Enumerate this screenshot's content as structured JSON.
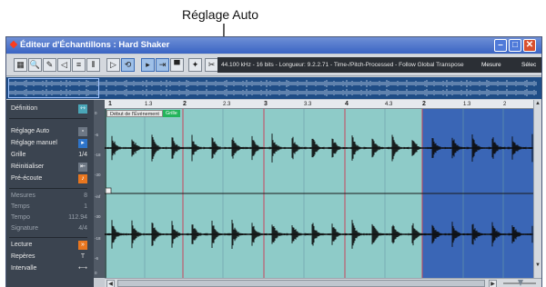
{
  "callout": {
    "text": "Réglage Auto"
  },
  "window": {
    "title": "Éditeur d'Échantillons : Hard Shaker",
    "info_text": "44.100 kHz - 16 bits - Longueur: 9.2.2.71 - Time-/Pitch-Processed - Follow Global Transpose",
    "mode_label": "Mesure",
    "select_label": "Sélec"
  },
  "toolbar": {
    "icons": [
      "range-select-icon",
      "zoom-icon",
      "pencil-icon",
      "audition-icon",
      "scrub-icon",
      "grid-icon",
      "play-icon",
      "loop-icon",
      "autoscroll-icon",
      "snap-icon",
      "hitpoints-icon",
      "warp-icon"
    ]
  },
  "inspector": {
    "definition": "Définition",
    "reglage_auto": "Réglage Auto",
    "reglage_manuel": "Réglage manuel",
    "grille": "Grille",
    "grille_val": "1/4",
    "reinitialiser": "Réinitialiser",
    "pre_ecoute": "Pré-écoute",
    "mesures": "Mesures",
    "mesures_val": "8",
    "temps": "Temps",
    "temps_val": "1",
    "tempo": "Tempo",
    "tempo_val": "112.94",
    "signature": "Signature",
    "signature_val": "4/4",
    "lecture": "Lecture",
    "reperes": "Repères",
    "intervalle": "Intervalle"
  },
  "ruler": {
    "labels": [
      "1",
      "1.3",
      "2",
      "2.3",
      "3",
      "3.3",
      "4",
      "4.3",
      "2",
      "1.3",
      "2"
    ]
  },
  "scale": {
    "ticks": [
      "0",
      "-6",
      "-18",
      "-30",
      "-inf",
      "-30",
      "-18",
      "-6",
      "0"
    ]
  },
  "events": {
    "start_label": "Début de l'Événement",
    "grille_label": "Grille"
  },
  "colors": {
    "waveform_bg": "#8ecbc8",
    "selection_bg": "#3a66b6",
    "hitpoint": "#c8465c",
    "inspector_bg": "#3b4450"
  }
}
